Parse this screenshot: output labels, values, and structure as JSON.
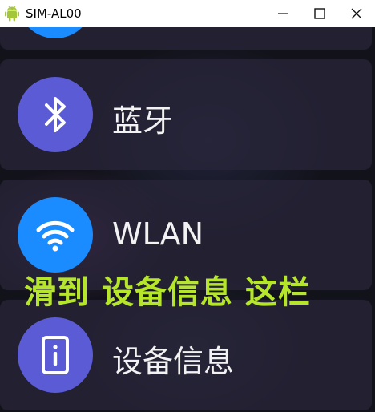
{
  "window": {
    "title": "SIM-AL00",
    "app_icon": "android-icon",
    "controls": [
      "minimize-icon",
      "maximize-icon",
      "close-icon"
    ]
  },
  "settings": {
    "items": [
      {
        "label": "蓝牙",
        "icon": "bluetooth-icon",
        "color": "#5b5bd6"
      },
      {
        "label": "WLAN",
        "icon": "wifi-icon",
        "color": "#1a8cff"
      },
      {
        "label": "设备信息",
        "icon": "device-info-icon",
        "color": "#5b5bd6"
      }
    ]
  },
  "overlay": {
    "text": "滑到 设备信息 这栏",
    "color": "#b6e62a"
  }
}
